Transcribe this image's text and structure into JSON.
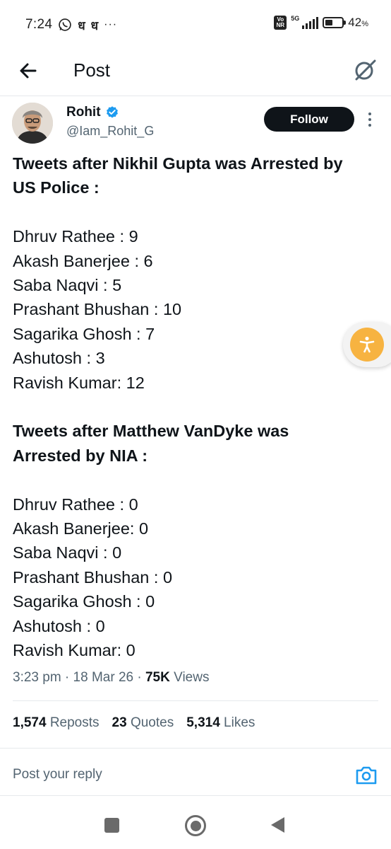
{
  "status_bar": {
    "time": "7:24",
    "notif_char_1": "ध",
    "notif_char_2": "ध",
    "more": "···",
    "network": "5G",
    "volte": "Vo NR",
    "battery_percent": "42",
    "battery_unit": "%",
    "battery_level": 0.42
  },
  "header": {
    "title": "Post",
    "icons": {
      "back": "back-arrow-icon",
      "grok": "grok-icon"
    }
  },
  "author": {
    "name": "Rohit",
    "handle": "@Iam_Rohit_G",
    "verified": true,
    "follow_label": "Follow"
  },
  "post": {
    "section1_heading_line1": "Tweets after Nikhil Gupta was Arrested by",
    "section1_heading_line2": "US Police :",
    "section1_items": [
      "Dhruv Rathee : 9",
      "Akash Banerjee : 6",
      "Saba Naqvi : 5",
      "Prashant Bhushan : 10",
      "Sagarika Ghosh : 7",
      "Ashutosh : 3",
      "Ravish Kumar: 12"
    ],
    "section2_heading_line1": "Tweets after Matthew VanDyke was",
    "section2_heading_line2": "Arrested by NIA :",
    "section2_items": [
      "Dhruv Rathee : 0",
      "Akash Banerjee: 0",
      "Saba Naqvi : 0",
      "Prashant Bhushan : 0",
      "Sagarika Ghosh : 0",
      "Ashutosh : 0",
      "Ravish Kumar: 0"
    ]
  },
  "meta": {
    "time": "3:23 pm",
    "date": "18 Mar 26",
    "views_count": "75K",
    "views_label": "Views"
  },
  "stats": {
    "reposts_count": "1,574",
    "reposts_label": "Reposts",
    "quotes_count": "23",
    "quotes_label": "Quotes",
    "likes_count": "5,314",
    "likes_label": "Likes"
  },
  "reply": {
    "placeholder": "Post your reply"
  },
  "colors": {
    "text": "#0f1419",
    "secondary": "#536471",
    "accent": "#1d9bf0",
    "fab": "#f7b341"
  }
}
